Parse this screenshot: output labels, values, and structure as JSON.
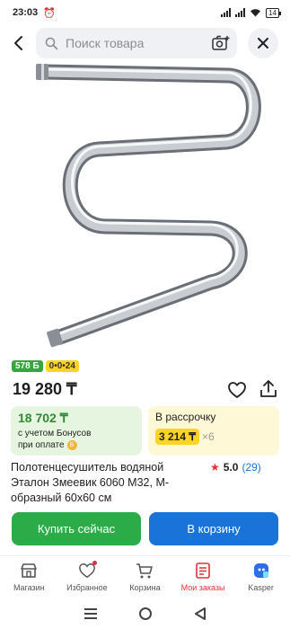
{
  "status": {
    "time": "23:03",
    "battery": "14"
  },
  "search": {
    "placeholder": "Поиск товара"
  },
  "badges": {
    "bonus": "578 Б",
    "installment": "0•0•24"
  },
  "product": {
    "price": "19 280 ₸",
    "title": "Полотенцесушитель водяной Эталон Змеевик 6060 М32, М-образный 60х60 см",
    "rating": "5.0",
    "reviews": "(29)"
  },
  "bonus_card": {
    "amount": "18 702 ₸",
    "note_line1": "с учетом Бонусов",
    "note_line2": "при оплате"
  },
  "installment_card": {
    "label": "В рассрочку",
    "amount": "3 214 ₸",
    "multiplier": "×6"
  },
  "actions": {
    "buy_now": "Купить сейчас",
    "add_to_cart": "В корзину"
  },
  "nav": {
    "items": [
      {
        "label": "Магазин",
        "icon": "store-icon"
      },
      {
        "label": "Избранное",
        "icon": "heart-icon"
      },
      {
        "label": "Корзина",
        "icon": "cart-icon"
      },
      {
        "label": "Мои заказы",
        "icon": "orders-icon"
      },
      {
        "label": "Kasper",
        "icon": "kasper-icon"
      }
    ]
  },
  "colors": {
    "green": "#2cab49",
    "blue": "#1a73d9",
    "accent_red": "#e0303c",
    "yellow": "#ffd426"
  }
}
